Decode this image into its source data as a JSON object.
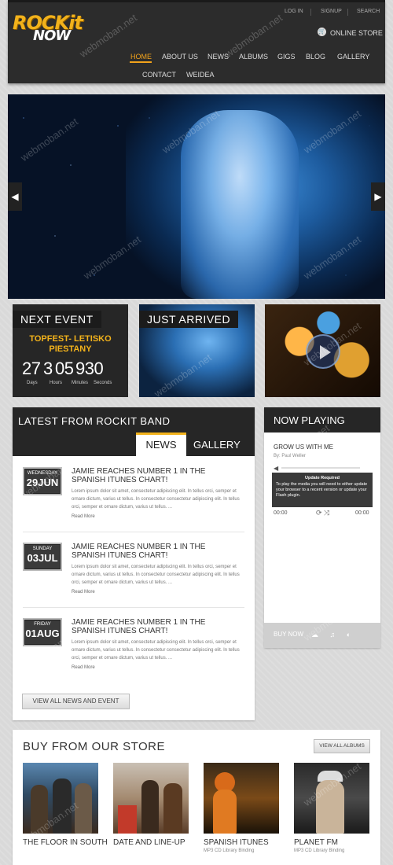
{
  "header": {
    "logo_line1": "ROCKit",
    "logo_line2": "NOW",
    "top_links": [
      "LOG IN",
      "SIGNUP",
      "SEARCH"
    ],
    "store_icon_glyph": "🛒",
    "store_link": "ONLINE STORE",
    "nav": [
      "HOME",
      "ABOUT US",
      "NEWS",
      "ALBUMS",
      "GIGS",
      "BLOG",
      "GALLERY",
      "CONTACT",
      "WEIDEA"
    ],
    "active_nav": "HOME",
    "accent_color": "#f2a31b"
  },
  "slider": {
    "prev_glyph": "◀",
    "next_glyph": "▶"
  },
  "next_event": {
    "title": "NEXT EVENT",
    "event_name": "TOPFEST- LETISKO PIESTANY",
    "countdown": [
      {
        "value": "27",
        "label": "Days"
      },
      {
        "value": "3",
        "label": "Hours"
      },
      {
        "value": "05",
        "label": "Minutes"
      },
      {
        "value": "930",
        "label": "Seconds"
      }
    ]
  },
  "just_arrived": {
    "title": "JUST ARRIVED"
  },
  "news": {
    "title": "LATEST FROM ROCKIT BAND",
    "tabs": [
      "NEWS",
      "GALLERY"
    ],
    "active_tab": "NEWS",
    "items": [
      {
        "weekday": "WEDNESDAY",
        "date": "29JUN",
        "title": "JAMIE REACHES NUMBER 1 IN THE SPANISH ITUNES CHART!",
        "body": "Lorem ipsum dolor sit amet, consectetur adipiscing elit. In tellus orci, semper et ornare dictum, varius ut tellus. In consectetur consectetur adipiscing elit. In tellus orci, semper et ornare dictum, varius ut tellus. ...",
        "read_more": "Read More"
      },
      {
        "weekday": "SUNDAY",
        "date": "03JUL",
        "title": "JAMIE REACHES NUMBER 1 IN THE SPANISH ITUNES CHART!",
        "body": "Lorem ipsum dolor sit amet, consectetur adipiscing elit. In tellus orci, semper et ornare dictum, varius ut tellus. In consectetur consectetur adipiscing elit. In tellus orci, semper et ornare dictum, varius ut tellus. ...",
        "read_more": "Read More"
      },
      {
        "weekday": "FRIDAY",
        "date": "01AUG",
        "title": "JAMIE REACHES NUMBER 1 IN THE SPANISH ITUNES CHART!",
        "body": "Lorem ipsum dolor sit amet, consectetur adipiscing elit. In tellus orci, semper et ornare dictum, varius ut tellus. In consectetur consectetur adipiscing elit. In tellus orci, semper et ornare dictum, varius ut tellus. ...",
        "read_more": "Read More"
      }
    ],
    "view_all": "VIEW ALL NEWS AND EVENT"
  },
  "now_playing": {
    "title": "NOW PLAYING",
    "song": "GROW US WITH ME",
    "artist": "By: Paul Weller",
    "speaker_glyph": "◀",
    "notice_title": "Update Required",
    "notice_body": "To play the media you will need to either update your browser to a recent version or update your Flash plugin.",
    "time_start": "00:00",
    "time_end": "00:00",
    "controls": "⟳ ⤨",
    "buy_now": "BUY NOW",
    "buy_icons": "☁ ♫ ◐"
  },
  "store": {
    "title": "BUY FROM OUR STORE",
    "view_all": "VIEW ALL ALBUMS",
    "albums": [
      {
        "title": "THE FLOOR IN SOUTH",
        "subtitle": ""
      },
      {
        "title": "DATE AND LINE-UP",
        "subtitle": ""
      },
      {
        "title": "SPANISH ITUNES",
        "subtitle": "MP3 CD Library Binding"
      },
      {
        "title": "PLANET FM",
        "subtitle": "MP3 CD Library Binding"
      }
    ]
  },
  "watermark": "webmoban.net"
}
